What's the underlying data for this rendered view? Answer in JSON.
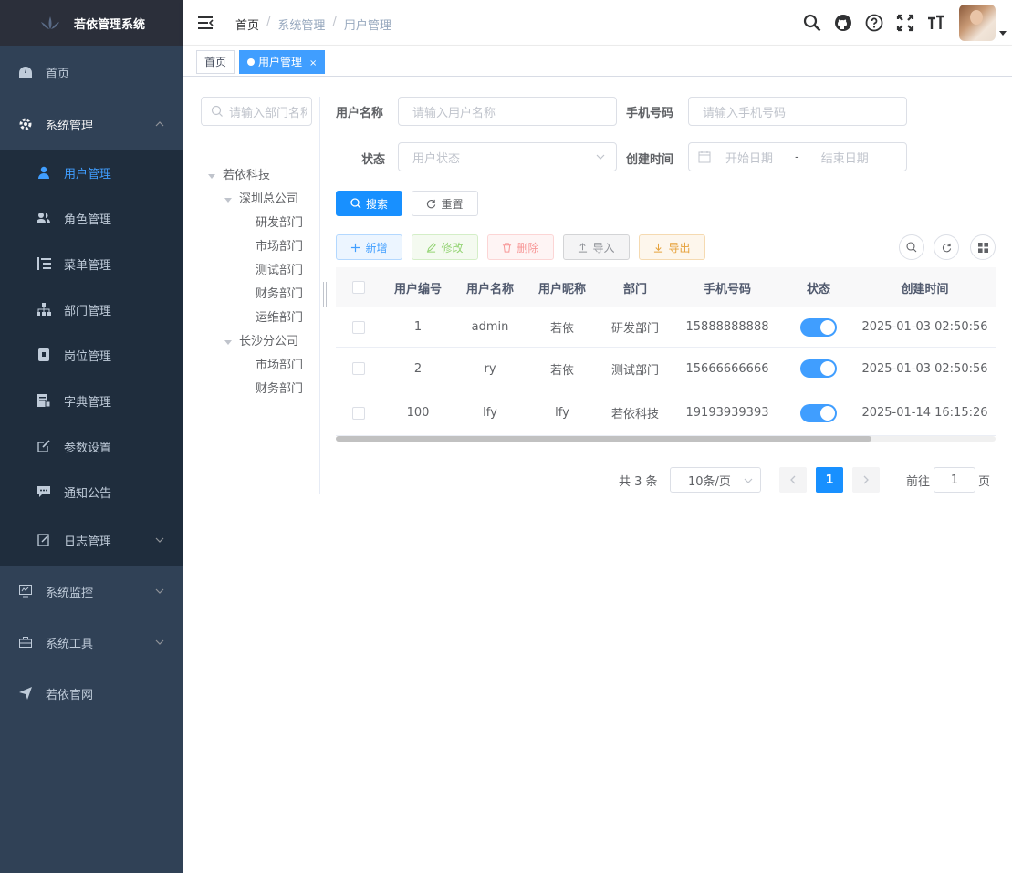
{
  "sidebar": {
    "logo_text": "若依管理系统",
    "items": {
      "home": "首页",
      "system": "系统管理",
      "user": "用户管理",
      "role": "角色管理",
      "menu": "菜单管理",
      "dept": "部门管理",
      "post": "岗位管理",
      "dict": "字典管理",
      "config": "参数设置",
      "notice": "通知公告",
      "log": "日志管理",
      "monitor": "系统监控",
      "tool": "系统工具",
      "site": "若依官网"
    },
    "colors": {
      "bg": "#304156",
      "sub_bg": "#1f2d3d",
      "active": "#409eff"
    }
  },
  "navbar": {
    "breadcrumb": [
      "首页",
      "系统管理",
      "用户管理"
    ],
    "breadcrumb_sep": "/"
  },
  "tags": {
    "home": "首页",
    "current": "用户管理",
    "close": "×"
  },
  "tree": {
    "search_placeholder": "请输入部门名称",
    "nodes": {
      "root": "若依科技",
      "sz": "深圳总公司",
      "sz_dev": "研发部门",
      "sz_mkt": "市场部门",
      "sz_test": "测试部门",
      "sz_fin": "财务部门",
      "sz_ops": "运维部门",
      "cs": "长沙分公司",
      "cs_mkt": "市场部门",
      "cs_fin": "财务部门"
    }
  },
  "search": {
    "username_label": "用户名称",
    "username_placeholder": "请输入用户名称",
    "phone_label": "手机号码",
    "phone_placeholder": "请输入手机号码",
    "status_label": "状态",
    "status_placeholder": "用户状态",
    "time_label": "创建时间",
    "start_placeholder": "开始日期",
    "range_sep": "-",
    "end_placeholder": "结束日期",
    "search_btn": "搜索",
    "reset_btn": "重置"
  },
  "toolbar": {
    "add": "新增",
    "edit": "修改",
    "delete": "删除",
    "import": "导入",
    "export": "导出"
  },
  "table": {
    "headers": {
      "id": "用户编号",
      "name": "用户名称",
      "nick": "用户昵称",
      "dept": "部门",
      "phone": "手机号码",
      "status": "状态",
      "time": "创建时间"
    },
    "rows": [
      {
        "id": "1",
        "name": "admin",
        "nick": "若依",
        "dept": "研发部门",
        "phone": "15888888888",
        "status": true,
        "time": "2025-01-03 02:50:56"
      },
      {
        "id": "2",
        "name": "ry",
        "nick": "若依",
        "dept": "测试部门",
        "phone": "15666666666",
        "status": true,
        "time": "2025-01-03 02:50:56"
      },
      {
        "id": "100",
        "name": "lfy",
        "nick": "lfy",
        "dept": "若依科技",
        "phone": "19193939393",
        "status": true,
        "time": "2025-01-14 16:15:26"
      }
    ]
  },
  "pagination": {
    "total": "共 3 条",
    "page_size": "10条/页",
    "current": "1",
    "goto_label": "前往",
    "goto_value": "1",
    "goto_unit": "页"
  }
}
